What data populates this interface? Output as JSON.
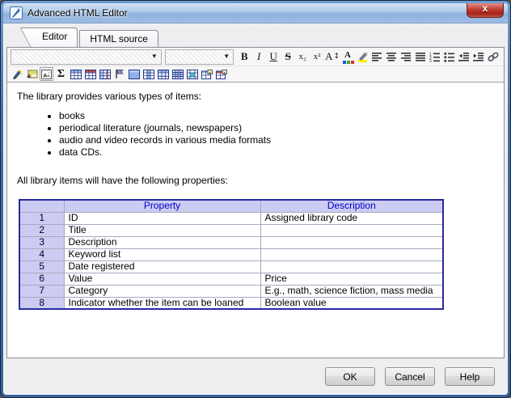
{
  "window": {
    "title": "Advanced HTML Editor",
    "close_label": "x"
  },
  "tabs": [
    {
      "label": "Editor",
      "active": true
    },
    {
      "label": "HTML source",
      "active": false
    }
  ],
  "toolbar": {
    "font_family_value": "",
    "font_size_value": "",
    "buttons": {
      "bold": "B",
      "italic": "I",
      "underline": "U",
      "strikethrough": "S",
      "subscript": "x₂",
      "superscript": "x²",
      "font_size_letter": "A",
      "font_size_arrows": "↕",
      "font_color_letter": "A",
      "sigma": "Σ"
    }
  },
  "content": {
    "intro": "The library provides various types of items:",
    "bullets": [
      "books",
      "periodical literature (journals, newspapers)",
      "audio and video records in various media formats",
      "data CDs."
    ],
    "properties_intro": "All library items will have the following properties:",
    "table": {
      "headers": [
        "",
        "Property",
        "Description"
      ],
      "rows": [
        [
          "1",
          "ID",
          "Assigned library code"
        ],
        [
          "2",
          "Title",
          ""
        ],
        [
          "3",
          "Description",
          ""
        ],
        [
          "4",
          "Keyword list",
          ""
        ],
        [
          "5",
          "Date registered",
          ""
        ],
        [
          "6",
          "Value",
          "Price"
        ],
        [
          "7",
          "Category",
          "E.g., math, science fiction, mass media"
        ],
        [
          "8",
          "Indicator whether the item can be loaned",
          "Boolean value"
        ]
      ]
    }
  },
  "footer": {
    "ok": "OK",
    "cancel": "Cancel",
    "help": "Help"
  },
  "colors": {
    "table_header_bg": "#ccccf2",
    "table_header_text": "#0000cc",
    "table_outer_border": "#2a2aa0",
    "titlebar_blue": "#9dbce3",
    "close_button_red": "#bc3a2e",
    "highlight_yellow": "#ffee00"
  }
}
